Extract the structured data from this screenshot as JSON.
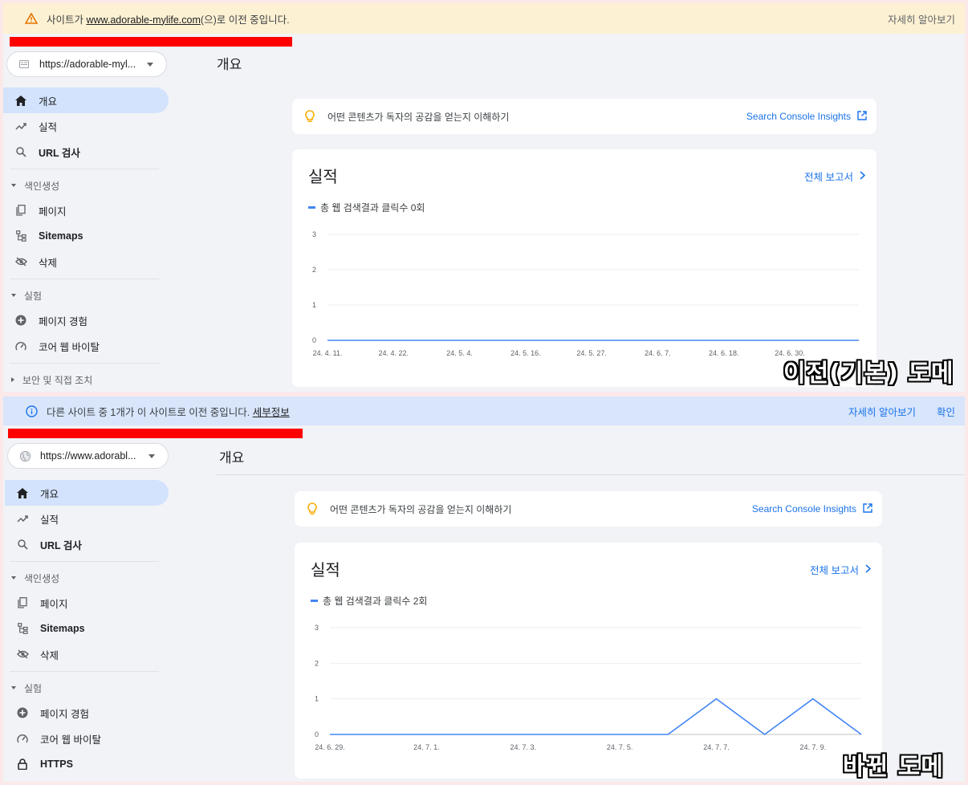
{
  "colors": {
    "accent": "#1a73e8",
    "line": "#4285f4",
    "warn_bg": "#fdf1d3",
    "info_bg": "#d8e5fb",
    "red_bar": "#ff0000",
    "nav_active": "#d3e3fd"
  },
  "top": {
    "banner": {
      "icon": "warning-icon",
      "prefix": "사이트가 ",
      "link": "www.adorable-mylife.com",
      "suffix": "(으)로 이전 중입니다.",
      "action": "자세히 알아보기"
    },
    "property": {
      "icon": "site-icon",
      "label": "https://adorable-myl..."
    },
    "page_title": "개요",
    "nav": {
      "overview": "개요",
      "performance": "실적",
      "url_inspection": "URL 검사",
      "group_indexing": "색인생성",
      "pages": "페이지",
      "sitemaps": "Sitemaps",
      "removals": "삭제",
      "group_experience": "실험",
      "page_experience": "페이지 경험",
      "core_web_vitals": "코어 웹 바이탈",
      "group_security": "보안 및 직접 조치"
    },
    "insights": {
      "text": "어떤 콘텐츠가 독자의 공감을 얻는지 이해하기",
      "link": "Search Console Insights"
    },
    "performance": {
      "title": "실적",
      "link": "전체 보고서",
      "legend": "총 웹 검색결과 클릭수 0회"
    },
    "overlay": "이전(기본) 도메인"
  },
  "bottom": {
    "banner": {
      "icon": "info-icon",
      "text": "다른 사이트 중 1개가 이 사이트로 이전 중입니다. ",
      "link": "세부정보",
      "action_learn": "자세히 알아보기",
      "action_ok": "확인"
    },
    "property": {
      "icon": "globe-icon",
      "label": "https://www.adorabl..."
    },
    "page_title": "개요",
    "nav": {
      "overview": "개요",
      "performance": "실적",
      "url_inspection": "URL 검사",
      "group_indexing": "색인생성",
      "pages": "페이지",
      "sitemaps": "Sitemaps",
      "removals": "삭제",
      "group_experience": "실험",
      "page_experience": "페이지 경험",
      "core_web_vitals": "코어 웹 바이탈",
      "https": "HTTPS"
    },
    "insights": {
      "text": "어떤 콘텐츠가 독자의 공감을 얻는지 이해하기",
      "link": "Search Console Insights"
    },
    "performance": {
      "title": "실적",
      "link": "전체 보고서",
      "legend": "총 웹 검색결과 클릭수 2회"
    },
    "overlay": "바뀐 도메인"
  },
  "chart_data": [
    {
      "type": "line",
      "series": [
        {
          "values": [
            0,
            0,
            0,
            0,
            0,
            0,
            0,
            0,
            0
          ]
        }
      ],
      "x_tick_labels": [
        "24. 4. 11.",
        "24. 4. 22.",
        "24. 5. 4.",
        "24. 5. 16.",
        "24. 5. 27.",
        "24. 6. 7.",
        "24. 6. 18.",
        "24. 6. 30."
      ],
      "yticks": [
        0,
        1,
        2,
        3
      ],
      "ylim": [
        0,
        3
      ],
      "grid": true
    },
    {
      "type": "line",
      "x": [
        "24. 6. 29.",
        "24. 6. 30.",
        "24. 7. 1.",
        "24. 7. 2.",
        "24. 7. 3.",
        "24. 7. 4.",
        "24. 7. 5.",
        "24. 7. 6.",
        "24. 7. 7.",
        "24. 7. 8.",
        "24. 7. 9.",
        "24. 7. 10."
      ],
      "series": [
        {
          "values": [
            0,
            0,
            0,
            0,
            0,
            0,
            0,
            0,
            1,
            0,
            1,
            0
          ]
        }
      ],
      "x_tick_labels": [
        "24. 6. 29.",
        "24. 7. 1.",
        "24. 7. 3.",
        "24. 7. 5.",
        "24. 7. 7.",
        "24. 7. 9."
      ],
      "yticks": [
        0,
        1,
        2,
        3
      ],
      "ylim": [
        0,
        3
      ],
      "grid": true
    }
  ]
}
